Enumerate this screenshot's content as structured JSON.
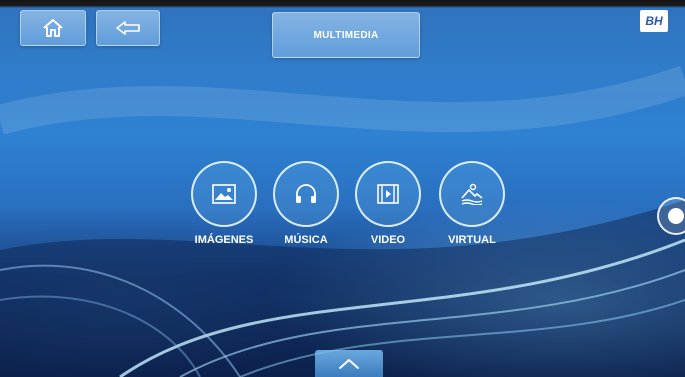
{
  "header": {
    "home_icon": "home-icon",
    "back_icon": "back-arrow-icon",
    "title": "MULTIMEDIA",
    "brand": "BH"
  },
  "menu": {
    "items": [
      {
        "label": "IMÁGENES",
        "icon": "image-icon"
      },
      {
        "label": "MÚSICA",
        "icon": "headphones-icon"
      },
      {
        "label": "VIDEO",
        "icon": "video-icon"
      },
      {
        "label": "VIRTUAL",
        "icon": "landscape-icon"
      }
    ]
  },
  "bottom": {
    "icon": "chevron-up-icon"
  },
  "side": {
    "icon": "side-handle-icon"
  },
  "colors": {
    "accent": "#2f82d2",
    "text": "#ffffff"
  }
}
